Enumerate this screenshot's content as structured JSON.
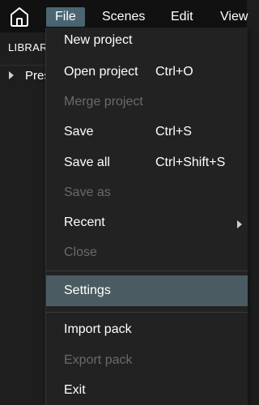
{
  "menubar": {
    "items": [
      "File",
      "Scenes",
      "Edit",
      "View"
    ]
  },
  "library": {
    "title": "LIBRARY",
    "tree_item": "Presets"
  },
  "file_menu": {
    "items": [
      {
        "label": "New project",
        "shortcut": "",
        "enabled": true
      },
      {
        "label": "Open project",
        "shortcut": "Ctrl+O",
        "enabled": true
      },
      {
        "label": "Merge project",
        "shortcut": "",
        "enabled": false
      },
      {
        "label": "Save",
        "shortcut": "Ctrl+S",
        "enabled": true
      },
      {
        "label": "Save all",
        "shortcut": "Ctrl+Shift+S",
        "enabled": true
      },
      {
        "label": "Save as",
        "shortcut": "",
        "enabled": false
      },
      {
        "label": "Recent",
        "shortcut": "",
        "enabled": true,
        "submenu": true
      },
      {
        "label": "Close",
        "shortcut": "",
        "enabled": false
      },
      {
        "label": "Settings",
        "shortcut": "",
        "enabled": true,
        "highlighted": true
      },
      {
        "label": "Import pack",
        "shortcut": "",
        "enabled": true
      },
      {
        "label": "Export pack",
        "shortcut": "",
        "enabled": false
      },
      {
        "label": "Exit",
        "shortcut": "",
        "enabled": true
      }
    ]
  },
  "colors": {
    "menubar_bg": "#111111",
    "active_menu_bg": "#4a6672",
    "dropdown_bg": "#222222",
    "highlight_bg": "#4a5b62",
    "disabled_text": "#6a6a6a",
    "text": "#ffffff"
  }
}
